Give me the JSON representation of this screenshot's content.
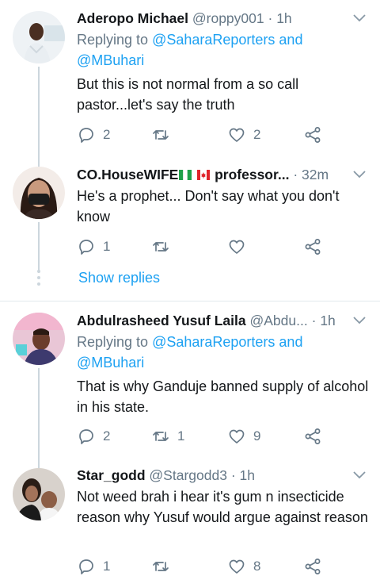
{
  "tweets": [
    {
      "name": "Aderopo Michael",
      "handle": "@roppy001",
      "dot": "·",
      "time": "1h",
      "replying_prefix": "Replying to",
      "replying_to_1": "@SaharaReporters and",
      "replying_to_2": "@MBuhari",
      "text": "But this is not normal from a so call pastor...let's say the truth",
      "replies": "2",
      "retweets": "",
      "likes": "2"
    },
    {
      "name": "CO.HouseWIFE",
      "name_suffix": "professor...",
      "flags": [
        "nigeria-flag",
        "canada-flag"
      ],
      "handle": "",
      "dot": "·",
      "time": "32m",
      "text": "He's a prophet... Don't say what you don't know",
      "replies": "1",
      "retweets": "",
      "likes": "",
      "show_replies": "Show replies"
    },
    {
      "name": "Abdulrasheed Yusuf Laila",
      "handle": "@Abdu...",
      "dot": "·",
      "time": "1h",
      "replying_prefix": "Replying to",
      "replying_to_1": "@SaharaReporters and",
      "replying_to_2": "@MBuhari",
      "text": "That is why Ganduje banned supply of alcohol in his state.",
      "replies": "2",
      "retweets": "1",
      "likes": "9"
    },
    {
      "name": "Star_godd",
      "handle": "@Stargodd3",
      "dot": "·",
      "time": "1h",
      "text": "Not weed brah i hear it's gum n insecticide reason why Yusuf would argue against reason",
      "replies": "1",
      "retweets": "",
      "likes": "8"
    }
  ],
  "colors": {
    "accent": "#1da1f2",
    "muted": "#657786",
    "line": "#ccd6dd"
  },
  "icons": [
    "reply-icon",
    "retweet-icon",
    "like-icon",
    "share-icon",
    "chevron-down-icon"
  ]
}
